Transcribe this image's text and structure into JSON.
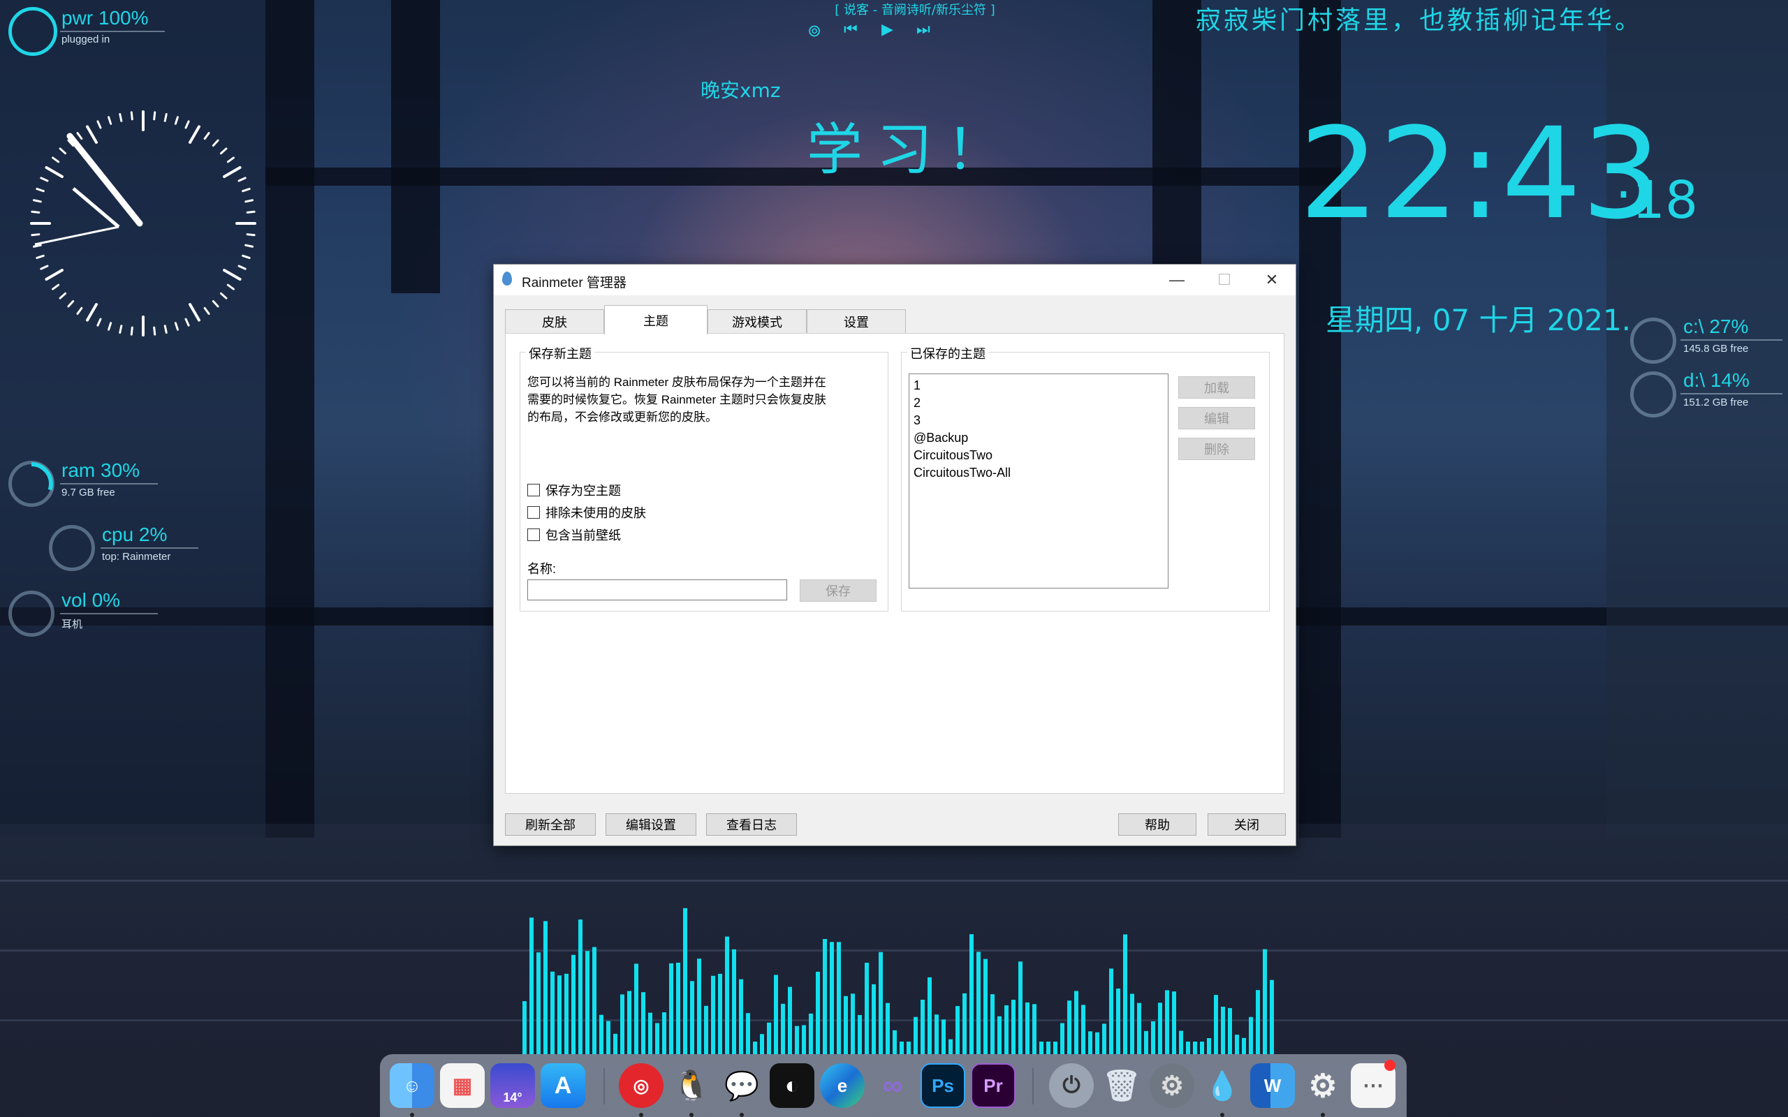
{
  "desktop": {
    "power": {
      "label": "pwr 100%",
      "sub": "plugged in",
      "percent": 100
    },
    "ram": {
      "label": "ram 30%",
      "sub": "9.7 GB free",
      "percent": 30
    },
    "cpu": {
      "label": "cpu 2%",
      "sub": "top: Rainmeter",
      "percent": 2
    },
    "vol": {
      "label": "vol 0%",
      "sub": "耳机",
      "percent": 0
    },
    "drive_c": {
      "label": "c:\\ 27%",
      "sub": "145.8 GB free",
      "percent": 27
    },
    "drive_d": {
      "label": "d:\\ 14%",
      "sub": "151.2 GB free",
      "percent": 14
    },
    "music": {
      "now_playing": "[ 说客 - 音阙诗听/新乐尘符 ]"
    },
    "greeting": "晚安xmz",
    "motto": "学习！",
    "poem": "寂寂柴门村落里，也教插柳记年华。",
    "clock": {
      "hm": "22:43",
      "sec": ":18"
    },
    "date": "星期四, 07 十月 2021.",
    "accent_color": "#1fd6e6"
  },
  "rainmeter": {
    "title": "Rainmeter 管理器",
    "tabs": [
      "皮肤",
      "主题",
      "游戏模式",
      "设置"
    ],
    "active_tab": "主题",
    "save_group": {
      "title": "保存新主题",
      "description_lines": [
        "您可以将当前的 Rainmeter 皮肤布局保存为一个主题并在",
        "需要的时候恢复它。恢复 Rainmeter 主题时只会恢复皮肤",
        "的布局，不会修改或更新您的皮肤。"
      ],
      "checkboxes": [
        "保存为空主题",
        "排除未使用的皮肤",
        "包含当前壁纸"
      ],
      "name_label": "名称:",
      "name_value": "",
      "save_button": "保存"
    },
    "saved_group": {
      "title": "已保存的主题",
      "items": [
        "1",
        "2",
        "3",
        "@Backup",
        "CircuitousTwo",
        "CircuitousTwo-All"
      ],
      "load_button": "加载",
      "edit_button": "编辑",
      "delete_button": "删除"
    },
    "footer": {
      "refresh_all": "刷新全部",
      "edit_settings": "编辑设置",
      "view_log": "查看日志",
      "help": "帮助",
      "close": "关闭"
    }
  },
  "dock": {
    "weather_temp": "14°",
    "apps": [
      "finder-icon",
      "launchpad-icon",
      "weather-icon",
      "app-store-icon",
      "netease-music-icon",
      "qq-icon",
      "wechat-icon",
      "capcut-icon",
      "edge-icon",
      "infinity-icon",
      "photoshop-icon",
      "premiere-icon",
      "power-icon",
      "trash-icon",
      "system-prefs-icon",
      "rainmeter-icon",
      "word-icon",
      "settings-gear-icon",
      "more-icon"
    ],
    "ps_label": "Ps",
    "pr_label": "Pr",
    "word_label": "W"
  }
}
